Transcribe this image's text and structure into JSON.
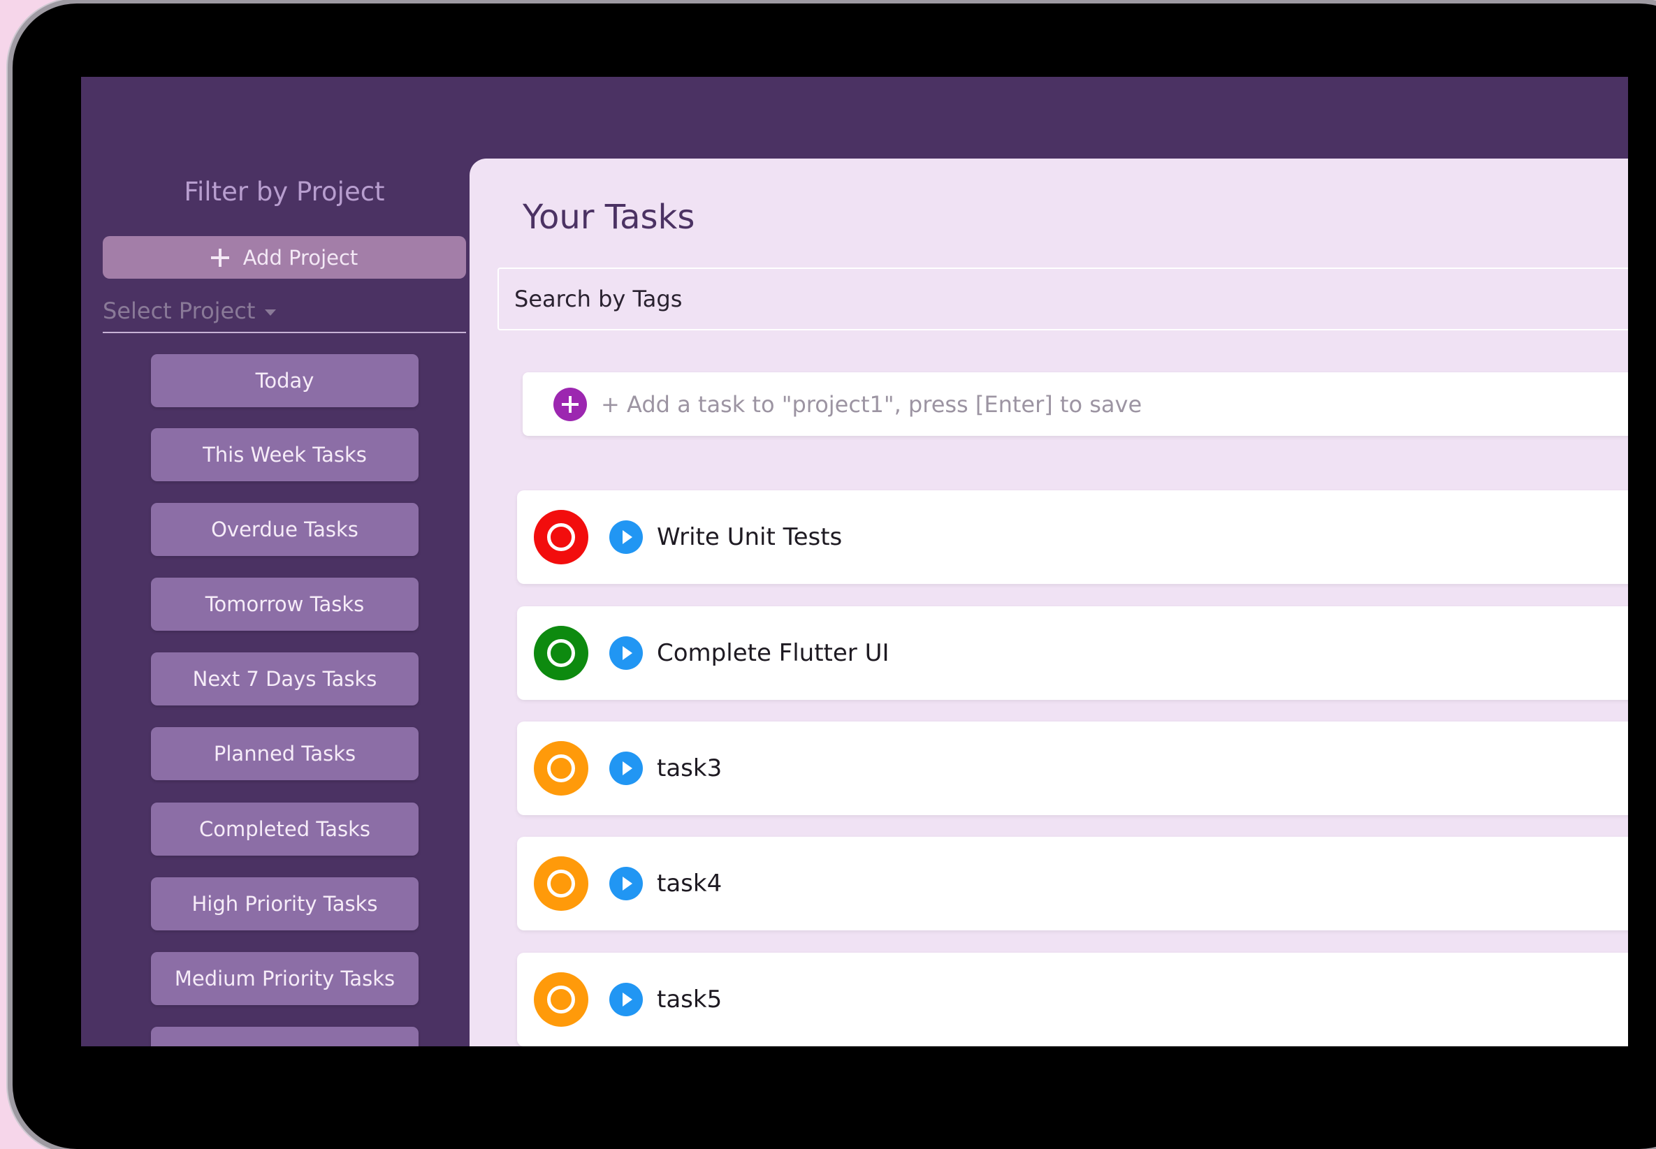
{
  "sidebar": {
    "title": "Filter by Project",
    "add_project_label": "Add Project",
    "select_project_placeholder": "Select Project",
    "filters": [
      {
        "label": "Today"
      },
      {
        "label": "This Week Tasks"
      },
      {
        "label": "Overdue Tasks"
      },
      {
        "label": "Tomorrow Tasks"
      },
      {
        "label": "Next 7 Days Tasks"
      },
      {
        "label": "Planned Tasks"
      },
      {
        "label": "Completed Tasks"
      },
      {
        "label": "High Priority Tasks"
      },
      {
        "label": "Medium Priority Tasks"
      },
      {
        "label": ""
      }
    ]
  },
  "main": {
    "title": "Your Tasks",
    "search_placeholder": "Search by Tags",
    "add_task_placeholder": "+ Add a task to \"project1\", press [Enter] to save",
    "tasks": [
      {
        "name": "Write Unit Tests",
        "priority_color": "#f20d0d"
      },
      {
        "name": "Complete Flutter UI",
        "priority_color": "#0d8a0f"
      },
      {
        "name": "task3",
        "priority_color": "#ff9a0a"
      },
      {
        "name": "task4",
        "priority_color": "#ff9a0a"
      },
      {
        "name": "task5",
        "priority_color": "#ff9a0a"
      }
    ]
  },
  "theme": {
    "sidebar_bg": "#4b3263",
    "main_bg": "#f0e2f4",
    "button_bg": "#8c6ea6",
    "accent_purple": "#9c27b0",
    "play_blue": "#2196f3"
  },
  "icons": {
    "add_project": "plus-icon",
    "select_caret": "caret-down-icon",
    "add_task": "add-circle-icon",
    "task_status": "priority-circle-icon",
    "task_play": "play-icon"
  }
}
